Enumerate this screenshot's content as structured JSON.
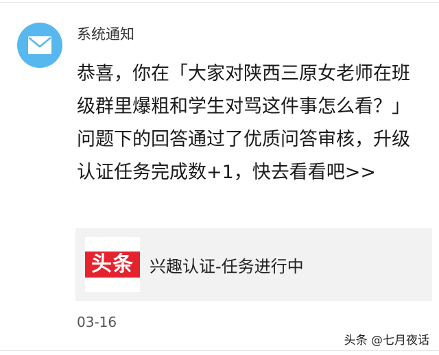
{
  "notification": {
    "sender": "系统通知",
    "avatar_icon": "mail-envelope-icon",
    "avatar_color": "#56b8ee",
    "message": "恭喜，你在「大家对陕西三原女老师在班级群里爆粗和学生对骂这件事怎么看？」问题下的回答通过了优质问答审核，升级认证任务完成数+1，快去看看吧>>",
    "date": "03-16"
  },
  "card": {
    "logo_text": "头条",
    "logo_color": "#e5232e",
    "title": "兴趣认证-任务进行中"
  },
  "watermark": "头条 @七月夜话"
}
